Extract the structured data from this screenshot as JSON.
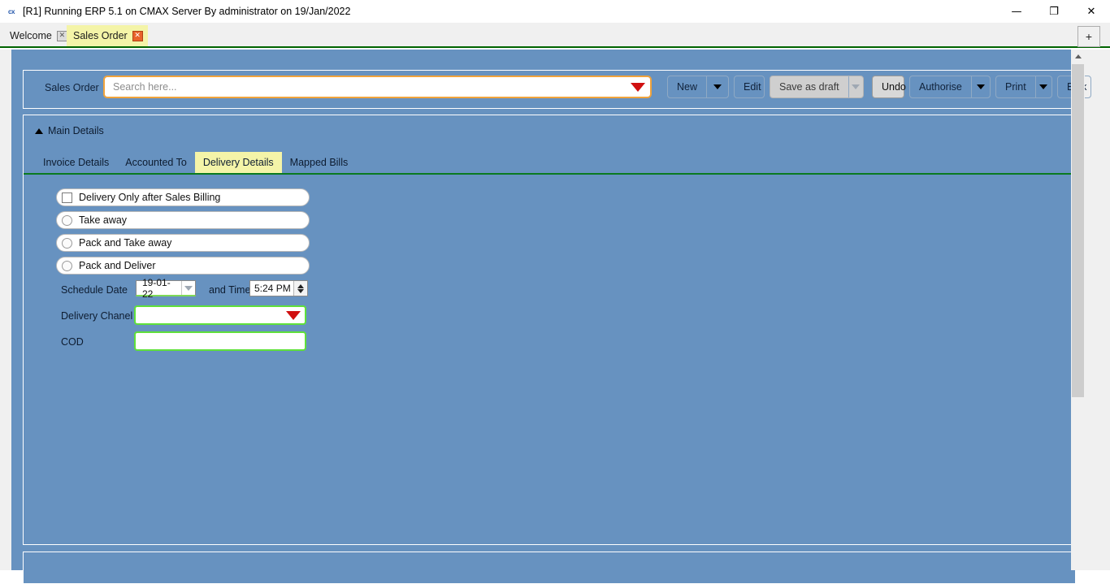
{
  "window": {
    "icon": "cx-app-icon",
    "title": "[R1] Running ERP 5.1 on CMAX Server By administrator on 19/Jan/2022",
    "controls": {
      "minimize": "—",
      "restore": "❐",
      "close": "✕"
    }
  },
  "tabstrip": {
    "tabs": [
      {
        "label": "Welcome",
        "close": "✕",
        "active": false
      },
      {
        "label": "Sales Order",
        "close": "✕",
        "active": true
      }
    ],
    "add_tab_label": "+"
  },
  "toolbar": {
    "module_label": "Sales Order",
    "search": {
      "value": "",
      "placeholder": "Search here...",
      "dropdown_icon": "caret-down-red"
    },
    "buttons": [
      {
        "name": "new",
        "label": "New",
        "has_arrow": true,
        "state": "normal"
      },
      {
        "name": "edit",
        "label": "Edit",
        "has_arrow": false,
        "state": "normal"
      },
      {
        "name": "save-as-draft",
        "label": "Save as draft",
        "has_arrow": true,
        "state": "disabled"
      },
      {
        "name": "undo",
        "label": "Undo",
        "has_arrow": false,
        "state": "hovered"
      },
      {
        "name": "authorise",
        "label": "Authorise",
        "has_arrow": true,
        "state": "normal"
      },
      {
        "name": "print",
        "label": "Print",
        "has_arrow": true,
        "state": "normal"
      },
      {
        "name": "bulk",
        "label": "Bulk",
        "has_arrow": false,
        "state": "normal"
      }
    ]
  },
  "main_details": {
    "section_title": "Main Details",
    "collapse_icon": "triangle-up",
    "tabs": [
      {
        "label": "Invoice Details",
        "active": false
      },
      {
        "label": "Accounted To",
        "active": false
      },
      {
        "label": "Delivery Details",
        "active": true
      },
      {
        "label": "Mapped Bills",
        "active": false
      }
    ]
  },
  "delivery_form": {
    "options": [
      {
        "type": "checkbox",
        "label": "Delivery Only after Sales Billing",
        "checked": false
      },
      {
        "type": "radio",
        "label": "Take away",
        "checked": false
      },
      {
        "type": "radio",
        "label": "Pack and Take away",
        "checked": false
      },
      {
        "type": "radio",
        "label": "Pack and Deliver",
        "checked": false
      }
    ],
    "schedule_date_label": "Schedule Date",
    "schedule_date_value": "19-01-22",
    "time_label": "and Time",
    "time_value": "5:24 PM",
    "delivery_channel_label": "Delivery Chanel",
    "delivery_channel_value": "",
    "cod_label": "COD",
    "cod_value": ""
  },
  "scrollbar": {
    "up_arrow": "arrow-up"
  },
  "colors": {
    "page_background": "#6792c0",
    "active_tab": "#f4f4a8",
    "accent_green": "#0a7a1e",
    "field_green_border": "#5fe03a",
    "search_border": "#f0a33c",
    "dropdown_red": "#d01010",
    "close_tab_orange": "#e8622a"
  }
}
